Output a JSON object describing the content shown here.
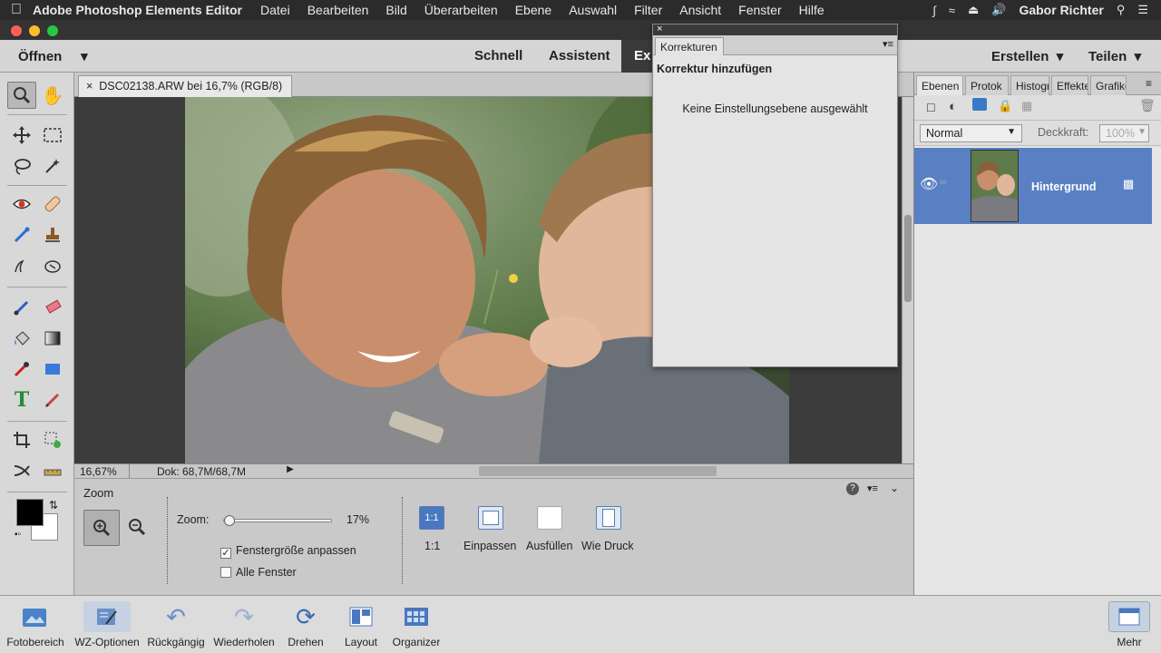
{
  "menubar": {
    "app": "Adobe Photoshop Elements Editor",
    "items": [
      "Datei",
      "Bearbeiten",
      "Bild",
      "Überarbeiten",
      "Ebene",
      "Auswahl",
      "Filter",
      "Ansicht",
      "Fenster",
      "Hilfe"
    ],
    "user": "Gabor Richter"
  },
  "topbar": {
    "open_label": "Öffnen",
    "modes": [
      "Schnell",
      "Assistent",
      "Ex"
    ],
    "create_label": "Erstellen",
    "share_label": "Teilen"
  },
  "document": {
    "tab_title": "DSC02138.ARW bei 16,7% (RGB/8)",
    "status_zoom": "16,67%",
    "status_doc": "Dok: 68,7M/68,7M"
  },
  "korrekturen": {
    "tab_label": "Korrekturen",
    "heading": "Korrektur hinzufügen",
    "message": "Keine Einstellungsebene ausgewählt"
  },
  "layers_panel": {
    "tabs": [
      "Ebenen",
      "Protok",
      "Histogr",
      "Effekte",
      "Grafike"
    ],
    "blend_mode": "Normal",
    "opacity_label": "Deckkraft:",
    "opacity_value": "100%",
    "layers": [
      {
        "name": "Hintergrund"
      }
    ]
  },
  "tool_options": {
    "tool_name": "Zoom",
    "zoom_label": "Zoom:",
    "zoom_value": "17%",
    "zoom_level": 0.17,
    "fit_window_label": "Fenstergröße anpassen",
    "fit_window_checked": true,
    "all_windows_label": "Alle Fenster",
    "all_windows_checked": false,
    "view_buttons": [
      {
        "icon": "1:1",
        "label": "1:1"
      },
      {
        "label": "Einpassen"
      },
      {
        "label": "Ausfüllen"
      },
      {
        "label": "Wie Druck"
      }
    ]
  },
  "bottombar": {
    "items": [
      "Fotobereich",
      "WZ-Optionen",
      "Rückgängig",
      "Wiederholen",
      "Drehen",
      "Layout",
      "Organizer"
    ],
    "more_label": "Mehr"
  },
  "colors": {
    "accent_blue": "#5a80c4",
    "ui_gray": "#d5d5d5",
    "dark_chrome": "#2b2b2b"
  }
}
